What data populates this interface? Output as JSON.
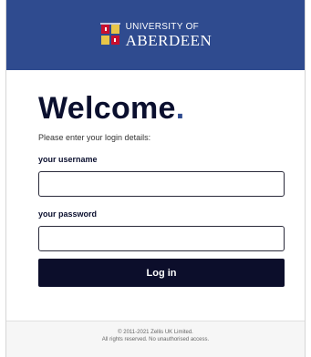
{
  "header": {
    "logo_line1": "UNIVERSITY OF",
    "logo_line2": "ABERDEEN",
    "background_color": "#2f4b8f"
  },
  "main": {
    "title": "Welcome",
    "title_dot": ".",
    "subtitle": "Please enter your login details:",
    "username_label": "your username",
    "username_value": "",
    "password_label": "your password",
    "password_value": "",
    "login_label": "Log in",
    "button_color": "#0c0e2b"
  },
  "footer": {
    "line1": "© 2011-2021 Zellis UK Limited.",
    "line2": "All rights reserved. No unauthorised access."
  },
  "icons": {
    "crest": "university-crest-icon"
  }
}
